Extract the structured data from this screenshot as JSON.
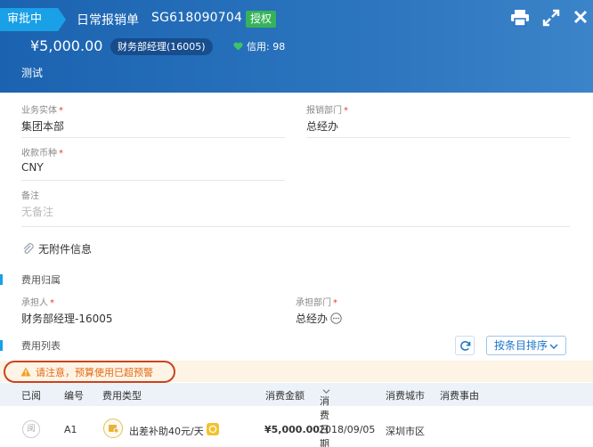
{
  "header": {
    "status": "审批中",
    "doc_type": "日常报销单",
    "doc_no": "SG618090704",
    "auth_badge": "授权",
    "amount": "¥5,000.00",
    "role": "财务部经理(16005)",
    "credit": "信用: 98",
    "note": "测试",
    "icons": [
      "print-icon",
      "expand-icon",
      "close-icon"
    ]
  },
  "form": {
    "entity_label": "业务实体",
    "entity_value": "集团本部",
    "dept_label": "报销部门",
    "dept_value": "总经办",
    "currency_label": "收款币种",
    "currency_value": "CNY",
    "remark_label": "备注",
    "remark_value": "无备注",
    "required_mark": "*"
  },
  "attachment": "无附件信息",
  "cost_section": {
    "title": "费用归属",
    "bearer_label": "承担人",
    "bearer_value": "财务部经理-16005",
    "bearer_dept_label": "承担部门",
    "bearer_dept_value": "总经办"
  },
  "list_section": {
    "title": "费用列表",
    "sort_label": "按条目排序"
  },
  "warning": "请注意，预算使用已超预警",
  "table": {
    "columns": [
      "已阅",
      "编号",
      "费用类型",
      "消费金额",
      "消费日期",
      "消费城市",
      "消费事由"
    ],
    "rows": [
      {
        "read": "阅",
        "no": "A1",
        "type": "出差补助40元/天",
        "amount": "¥5,000.00",
        "date": "2018/09/05",
        "city": "深圳市区",
        "reason": ""
      }
    ]
  },
  "colors": {
    "header_bg": "#1b63b0",
    "status_tag": "#19a0e6",
    "auth_badge": "#36b35a",
    "warning_text": "#e46a12",
    "warning_outline": "#c9441c",
    "accent": "#1b75c9"
  }
}
